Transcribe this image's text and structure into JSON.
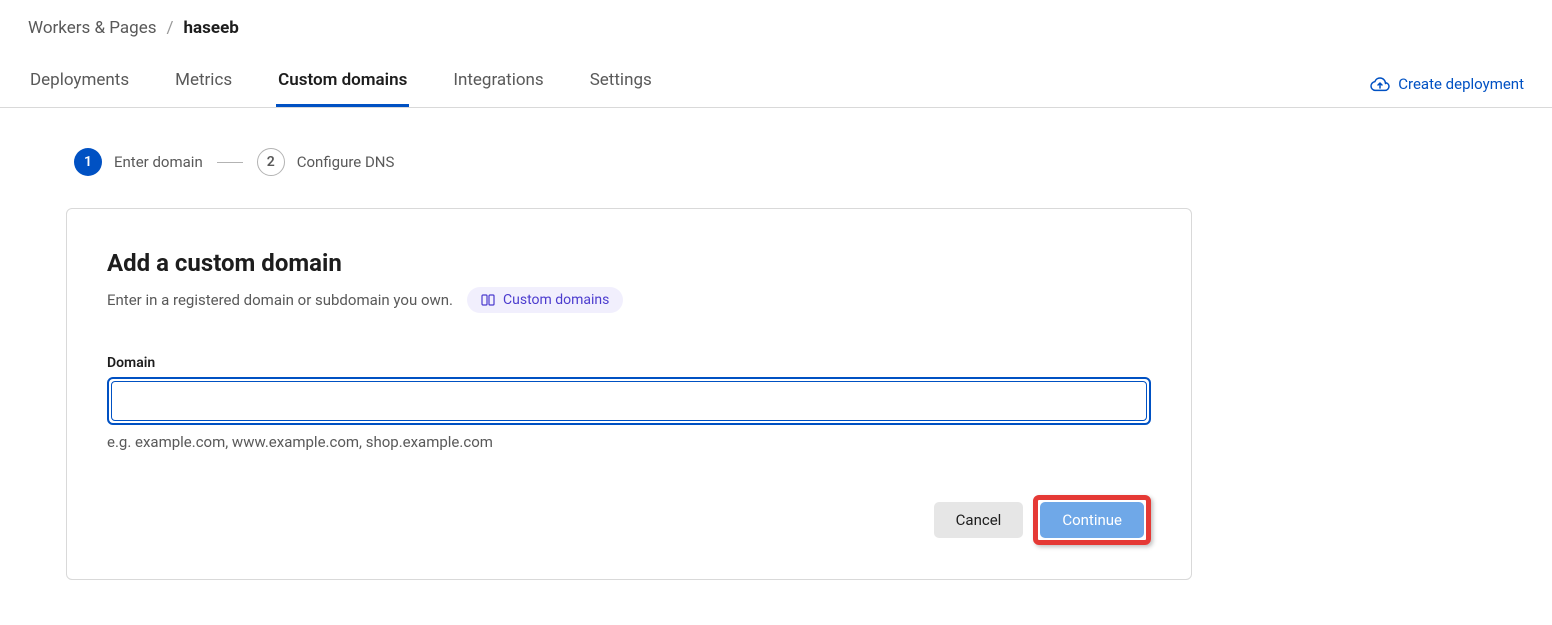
{
  "breadcrumb": {
    "root": "Workers & Pages",
    "separator": "/",
    "current": "haseeb"
  },
  "tabs": {
    "deployments": "Deployments",
    "metrics": "Metrics",
    "custom_domains": "Custom domains",
    "integrations": "Integrations",
    "settings": "Settings"
  },
  "actions": {
    "create_deployment": "Create deployment"
  },
  "stepper": {
    "step1": {
      "num": "1",
      "label": "Enter domain"
    },
    "step2": {
      "num": "2",
      "label": "Configure DNS"
    }
  },
  "card": {
    "title": "Add a custom domain",
    "subtitle": "Enter in a registered domain or subdomain you own.",
    "badge": "Custom domains",
    "field_label": "Domain",
    "field_value": "",
    "hint": "e.g. example.com, www.example.com, shop.example.com",
    "cancel": "Cancel",
    "continue": "Continue"
  }
}
